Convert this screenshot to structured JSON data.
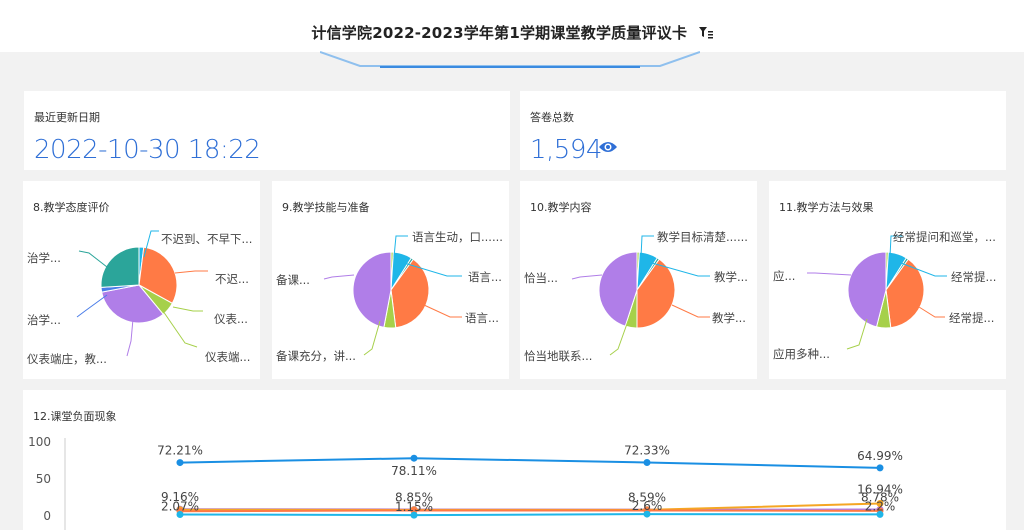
{
  "header": {
    "title": "计信学院2022-2023学年第1学期课堂教学质量评议卡"
  },
  "kpi": {
    "update_label": "最近更新日期",
    "update_value": "2022-10-30 18:22",
    "total_label": "答卷总数",
    "total_value": "1,594"
  },
  "colors": {
    "accent": "#2f6fd6",
    "teal": "#2ba59a",
    "orange": "#ff7a45",
    "purple": "#b07ee8",
    "lime": "#a6d04a",
    "cyan": "#1fb6e8",
    "blue": "#4a7de8"
  },
  "pies": [
    {
      "title": "8.教学态度评价",
      "labels": [
        "不迟到、不早下...",
        "不迟...",
        "仪表...",
        "仪表端...",
        "仪表端庄，教...",
        "治学...",
        "治学..."
      ],
      "slices": [
        {
          "value": 2,
          "color": "#1fb6e8"
        },
        {
          "value": 31,
          "color": "#ff7a45"
        },
        {
          "value": 6,
          "color": "#a6d04a"
        },
        {
          "value": 33,
          "color": "#b07ee8"
        },
        {
          "value": 2,
          "color": "#4a7de8"
        },
        {
          "value": 26,
          "color": "#2ba59a"
        }
      ]
    },
    {
      "title": "9.教学技能与准备",
      "labels": [
        "语言生动，口......",
        "语言...",
        "语言...",
        "备课充分，讲...",
        "备课..."
      ],
      "slices": [
        {
          "value": 1,
          "color": "#a6d04a"
        },
        {
          "value": 8,
          "color": "#1fb6e8"
        },
        {
          "value": 1,
          "color": "#2ba59a"
        },
        {
          "value": 38,
          "color": "#ff7a45"
        },
        {
          "value": 5,
          "color": "#a6d04a"
        },
        {
          "value": 47,
          "color": "#b07ee8"
        }
      ]
    },
    {
      "title": "10.教学内容",
      "labels": [
        "教学目标清楚......",
        "教学...",
        "教学...",
        "恰当地联系...",
        "恰当..."
      ],
      "slices": [
        {
          "value": 1,
          "color": "#a6d04a"
        },
        {
          "value": 8,
          "color": "#1fb6e8"
        },
        {
          "value": 1,
          "color": "#2ba59a"
        },
        {
          "value": 40,
          "color": "#ff7a45"
        },
        {
          "value": 5,
          "color": "#a6d04a"
        },
        {
          "value": 45,
          "color": "#b07ee8"
        }
      ]
    },
    {
      "title": "11.教学方法与效果",
      "labels": [
        "经常提问和巡堂，...",
        "经常提...",
        "经常提...",
        "应用多种...",
        "应..."
      ],
      "slices": [
        {
          "value": 1,
          "color": "#a6d04a"
        },
        {
          "value": 8,
          "color": "#1fb6e8"
        },
        {
          "value": 1,
          "color": "#2ba59a"
        },
        {
          "value": 38,
          "color": "#ff7a45"
        },
        {
          "value": 6,
          "color": "#a6d04a"
        },
        {
          "value": 46,
          "color": "#b07ee8"
        }
      ]
    }
  ],
  "chart_data": {
    "type": "line",
    "title": "12.课堂负面现象",
    "ylim": [
      0,
      100
    ],
    "yticks": [
      "0",
      "50",
      "100"
    ],
    "series": [
      {
        "values": [
          72.21,
          78.11,
          72.33,
          64.99
        ],
        "labels": [
          "72.21%",
          "78.11%",
          "72.33%",
          "64.99%"
        ],
        "color": "#1a8fe3"
      },
      {
        "values": [
          9.16,
          8.85,
          8.59,
          8.78
        ],
        "labels": [
          "9.16%",
          "8.85%",
          "8.59%",
          "8.78%"
        ],
        "color": "#b07ee8"
      },
      {
        "values": [
          8.5,
          8.3,
          8.2,
          16.94
        ],
        "labels": [
          "",
          "",
          "",
          "16.94%"
        ],
        "color": "#f5a623"
      },
      {
        "values": [
          6.5,
          7.5,
          7.5,
          7.0
        ],
        "labels": [
          "",
          "",
          "",
          ""
        ],
        "color": "#ff7a45"
      },
      {
        "values": [
          2.07,
          1.15,
          2.6,
          2.2
        ],
        "labels": [
          "2.07%",
          "1.15%",
          "2.6%",
          "2.2%"
        ],
        "color": "#1fb6e8"
      }
    ]
  }
}
